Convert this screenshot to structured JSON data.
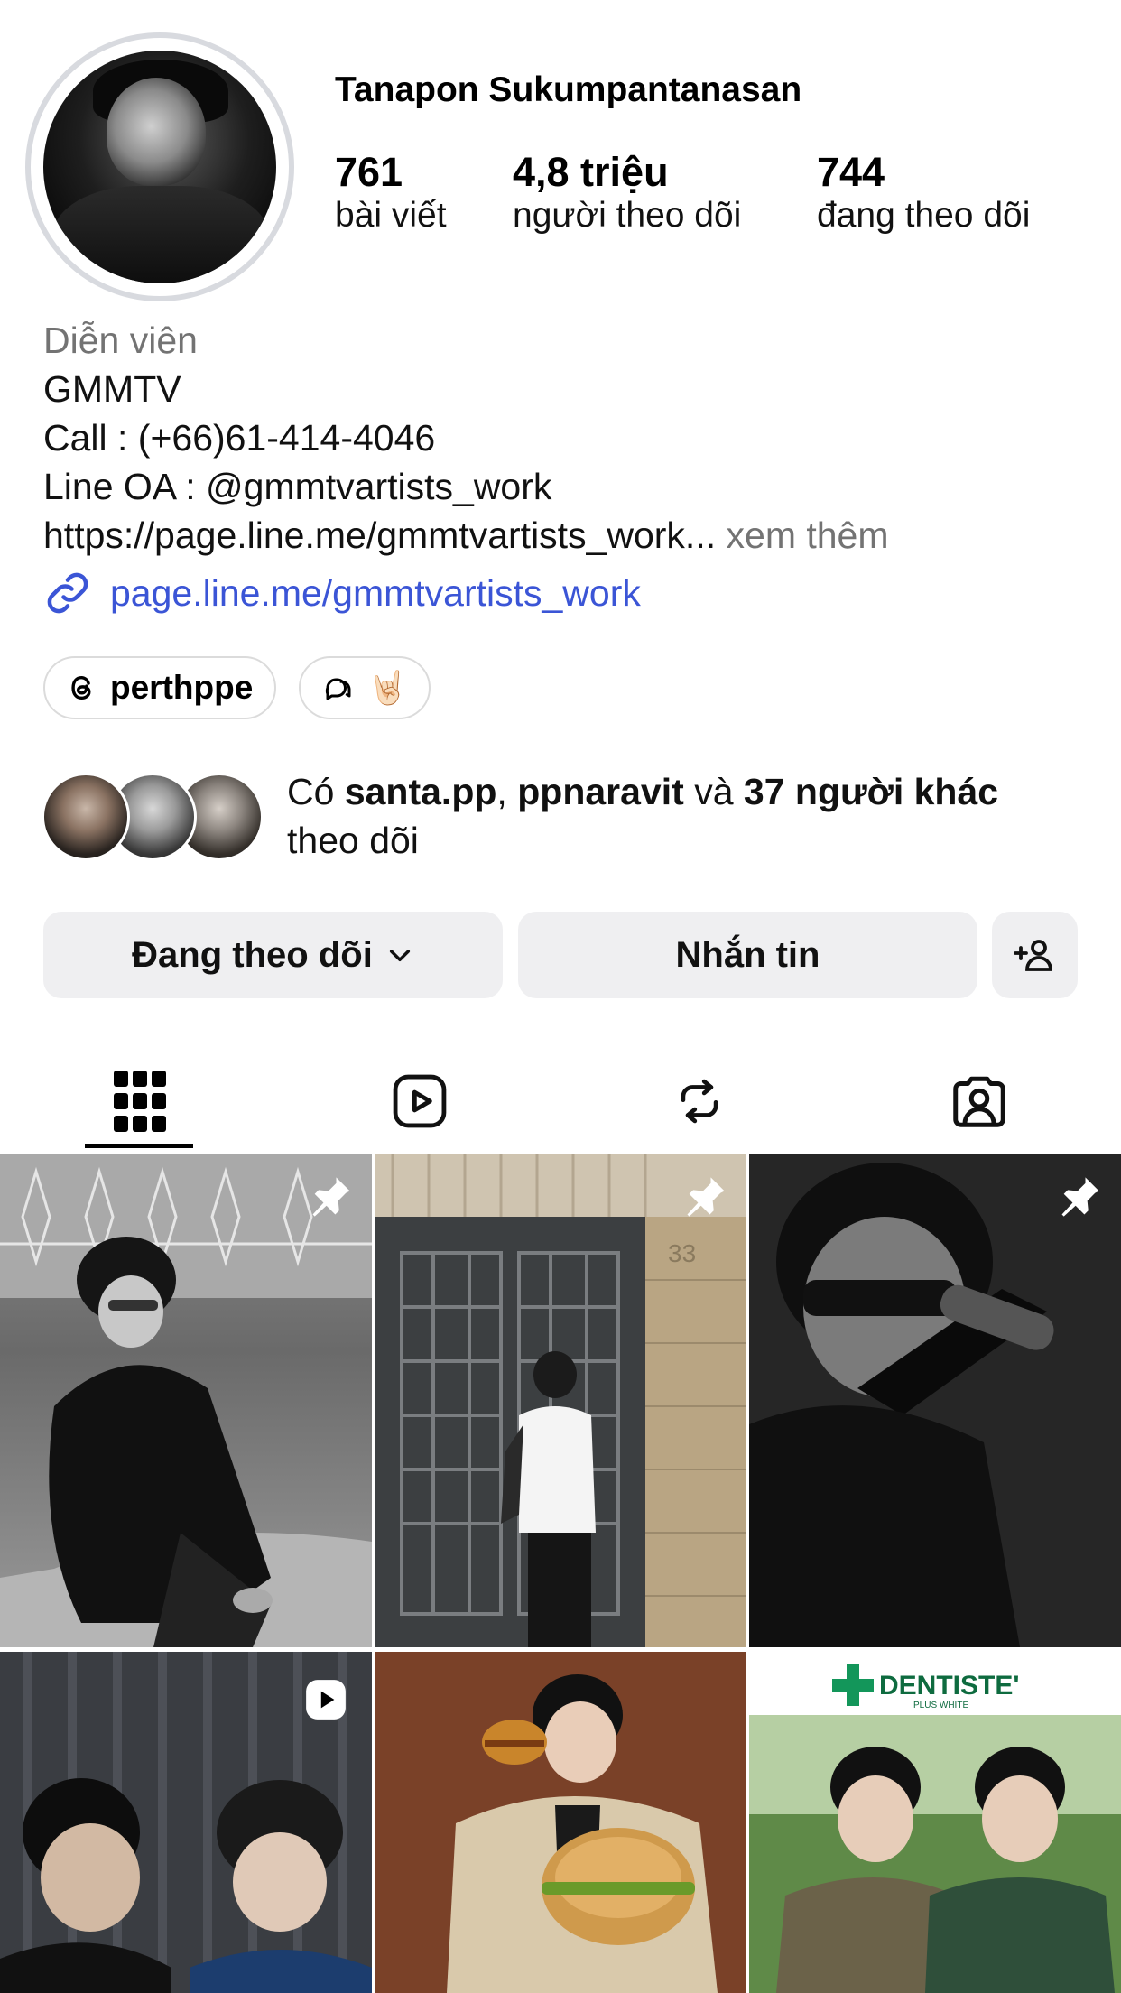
{
  "profile": {
    "username": "Tanapon Sukumpantanasan",
    "stats": [
      {
        "value": "761",
        "label": "bài viết"
      },
      {
        "value": "4,8 triệu",
        "label": "người theo dõi"
      },
      {
        "value": "744",
        "label": "đang theo dõi"
      }
    ],
    "category": "Diễn viên",
    "bio_lines": [
      "GMMTV",
      "Call : (+66)61-414-4046",
      "Line OA : @gmmtvartists_work"
    ],
    "bio_url_truncated": "https://page.line.me/gmmtvartists_work...",
    "see_more": "xem thêm",
    "link": "page.line.me/gmmtvartists_work",
    "threads_handle": "perthppe",
    "note_emoji": "🤘🏻"
  },
  "followed_by": {
    "prefix": "Có",
    "user1": "santa.pp",
    "sep": ",",
    "user2": "ppnaravit",
    "and": "và",
    "others": "37 người khác",
    "suffix": "theo dõi"
  },
  "actions": {
    "following": "Đang theo dõi",
    "message": "Nhắn tin"
  },
  "tabs": [
    "grid-icon",
    "reels-icon",
    "reposts-icon",
    "tagged-icon"
  ],
  "grid": {
    "ad_brand": "DENTISTE'",
    "ad_sub": "PLUS WHITE",
    "door_number": "33"
  }
}
